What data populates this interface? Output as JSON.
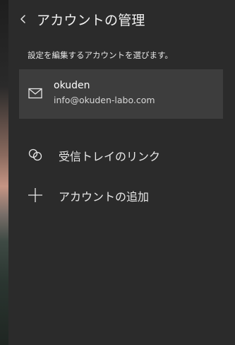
{
  "header": {
    "back_icon": "chevron-left-icon",
    "title": "アカウントの管理"
  },
  "instruction": "設定を編集するアカウントを選びます。",
  "accounts": [
    {
      "icon": "mail-icon",
      "name": "okuden",
      "email": "info@okuden-labo.com"
    }
  ],
  "actions": {
    "link_inboxes": {
      "icon": "link-icon",
      "label": "受信トレイのリンク"
    },
    "add_account": {
      "icon": "plus-icon",
      "label": "アカウントの追加"
    }
  },
  "colors": {
    "pane_background": "#2b2b2b",
    "card_background": "#3d3d3d",
    "text_primary": "#ffffff",
    "text_secondary": "#d8d8d8"
  }
}
